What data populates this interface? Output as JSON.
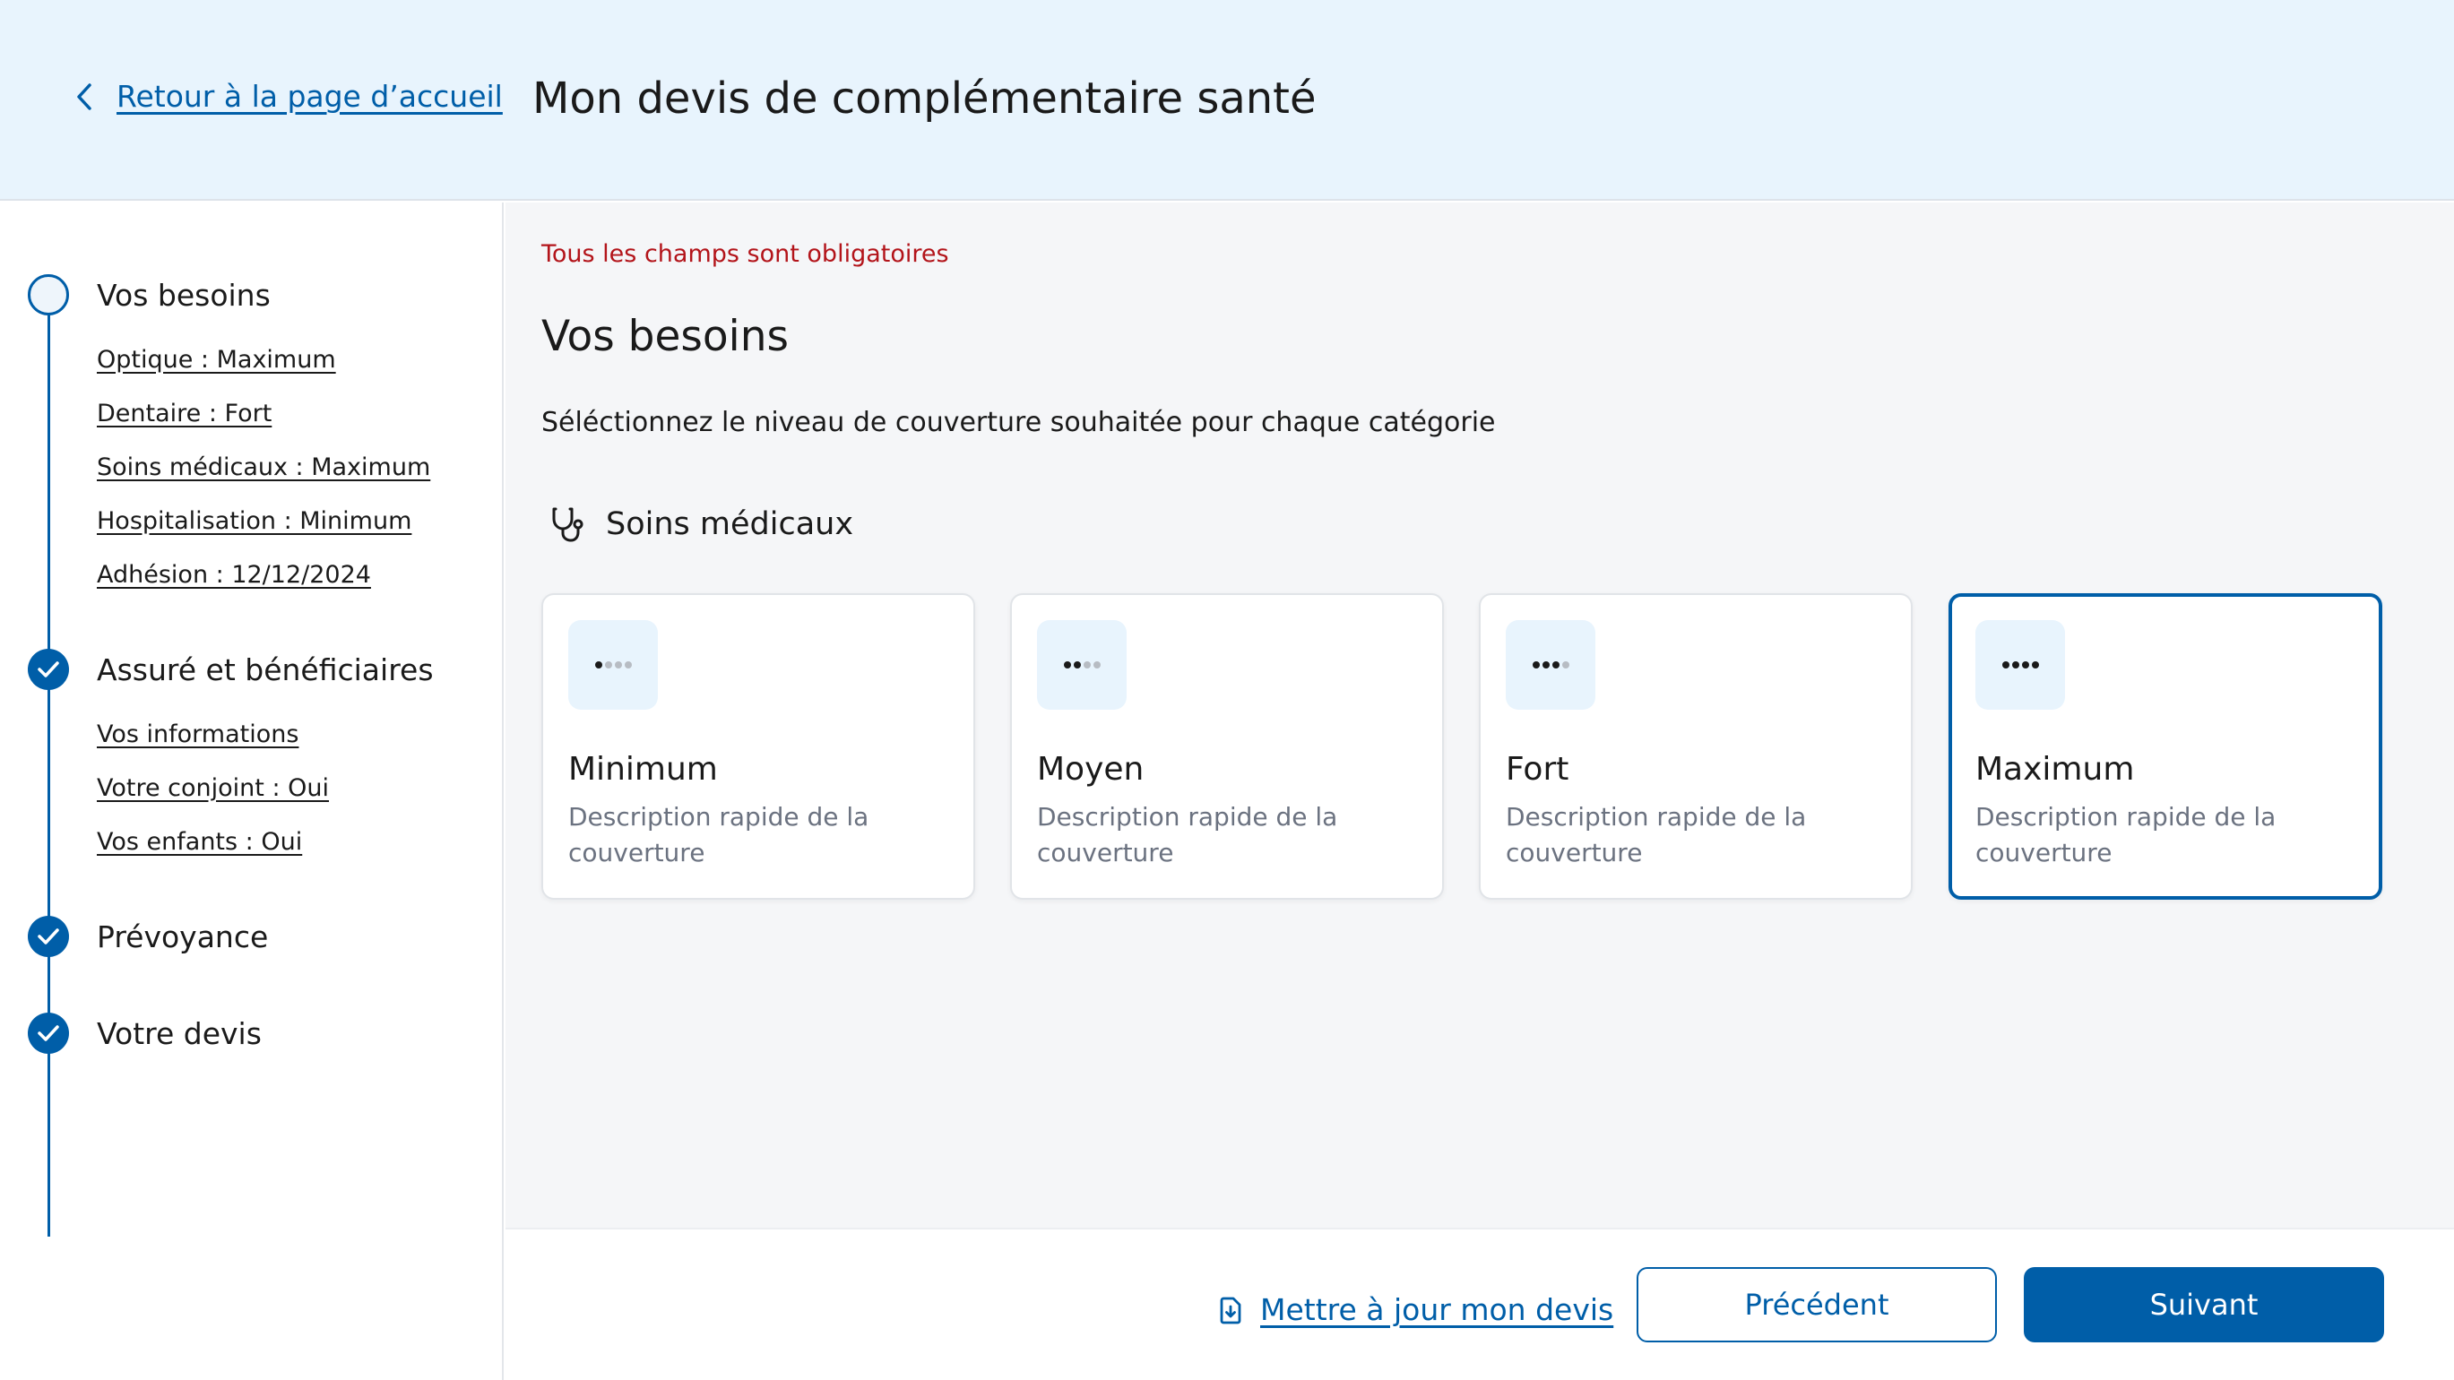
{
  "header": {
    "back_link": "Retour à la page d’accueil",
    "title": "Mon devis de complémentaire santé"
  },
  "sidebar": {
    "steps": [
      {
        "title": "Vos besoins",
        "status": "current",
        "items": [
          "Optique : Maximum",
          "Dentaire : Fort",
          "Soins médicaux : Maximum",
          "Hospitalisation : Minimum",
          "Adhésion : 12/12/2024"
        ]
      },
      {
        "title": "Assuré et bénéficiaires",
        "status": "done",
        "items": [
          "Vos informations",
          "Votre conjoint : Oui",
          "Vos enfants : Oui"
        ]
      },
      {
        "title": "Prévoyance",
        "status": "done",
        "items": []
      },
      {
        "title": "Votre devis",
        "status": "done",
        "items": []
      }
    ]
  },
  "main": {
    "required_note": "Tous les champs sont obligatoires",
    "section_title": "Vos besoins",
    "section_desc": "Séléctionnez le niveau de couverture souhaitée pour chaque catégorie",
    "category": {
      "icon": "stethoscope-icon",
      "label": "Soins médicaux"
    },
    "options": [
      {
        "title": "Minimum",
        "desc": "Description rapide de la couverture",
        "level": 1,
        "selected": false
      },
      {
        "title": "Moyen",
        "desc": "Description rapide de la couverture",
        "level": 2,
        "selected": false
      },
      {
        "title": "Fort",
        "desc": "Description rapide de la couverture",
        "level": 3,
        "selected": false
      },
      {
        "title": "Maximum",
        "desc": "Description rapide de la couverture",
        "level": 4,
        "selected": true
      }
    ]
  },
  "footer": {
    "update_link": "Mettre à jour mon devis",
    "previous_label": "Précédent",
    "next_label": "Suivant"
  },
  "colors": {
    "primary": "#005ea8",
    "header_bg": "#e8f4fd",
    "main_bg": "#f5f6f8",
    "error": "#b3141a"
  }
}
